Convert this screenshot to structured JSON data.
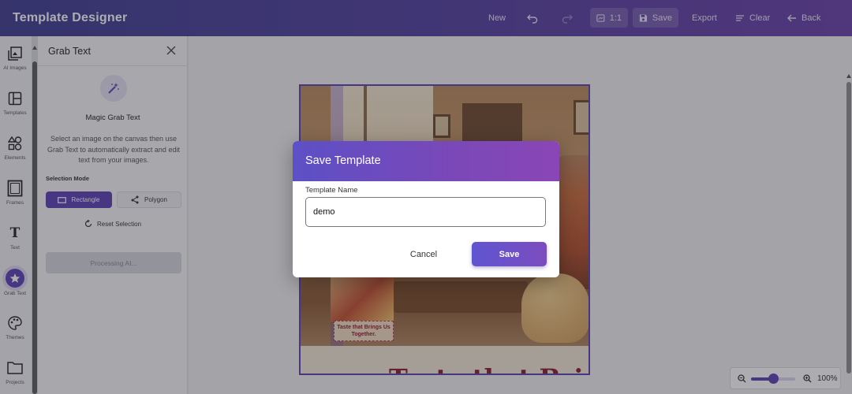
{
  "header": {
    "title": "Template Designer",
    "new_label": "New",
    "ratio_label": "1:1",
    "save_label": "Save",
    "export_label": "Export",
    "clear_label": "Clear",
    "back_label": "Back"
  },
  "rail": {
    "items": [
      {
        "label": "AI Images",
        "icon": "ai-images-icon"
      },
      {
        "label": "Templates",
        "icon": "templates-icon"
      },
      {
        "label": "Elements",
        "icon": "elements-icon"
      },
      {
        "label": "Frames",
        "icon": "frames-icon"
      },
      {
        "label": "Text",
        "icon": "text-icon"
      },
      {
        "label": "Grab Text",
        "icon": "grab-text-icon",
        "active": true
      },
      {
        "label": "Themes",
        "icon": "themes-icon"
      },
      {
        "label": "Projects",
        "icon": "projects-icon"
      }
    ]
  },
  "panel": {
    "title": "Grab Text",
    "magic_title": "Magic Grab Text",
    "description": "Select an image on the canvas then use Grab Text to automatically extract and edit text from your images.",
    "selection_mode_label": "Selection Mode",
    "mode_rectangle": "Rectangle",
    "mode_polygon": "Polygon",
    "reset_label": "Reset Selection",
    "processing_label": "Processing AI..."
  },
  "canvas": {
    "badge_text": "Taste that Brings Us Together.",
    "big_text": "Taste that Brings"
  },
  "modal": {
    "title": "Save Template",
    "field_label": "Template Name",
    "field_value": "demo",
    "cancel_label": "Cancel",
    "save_label": "Save"
  },
  "zoom": {
    "value_label": "100%",
    "level": 0.5
  },
  "colors": {
    "accent": "#5b3fb3",
    "header_start": "#3e3d8f",
    "header_end": "#6a40a8"
  }
}
